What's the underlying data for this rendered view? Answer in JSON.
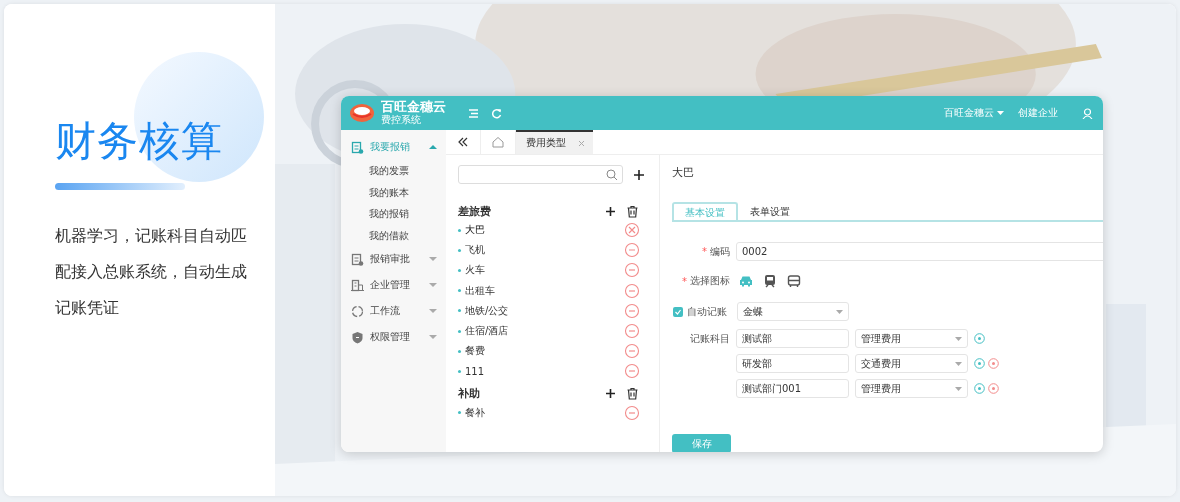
{
  "hero": {
    "title": "财务核算",
    "description": "机器学习，记账科目自动匹配接入总账系统，自动生成记账凭证"
  },
  "app": {
    "brand": {
      "name": "百旺金穗云",
      "subtitle": "费控系统"
    },
    "header": {
      "org": "百旺金穗云",
      "create": "创建企业"
    },
    "sidebar": [
      {
        "label": "我要报销",
        "kind": "receipt",
        "expanded": true,
        "children": [
          {
            "label": "我的发票"
          },
          {
            "label": "我的账本"
          },
          {
            "label": "我的报销"
          },
          {
            "label": "我的借款"
          }
        ]
      },
      {
        "label": "报销审批",
        "kind": "receipt",
        "expanded": false
      },
      {
        "label": "企业管理",
        "kind": "building",
        "expanded": false
      },
      {
        "label": "工作流",
        "kind": "cycle",
        "expanded": false
      },
      {
        "label": "权限管理",
        "kind": "shield",
        "expanded": false
      }
    ],
    "tabs": [
      {
        "label": "费用类型",
        "selected": true
      }
    ],
    "groups": [
      {
        "name": "差旅费",
        "items": [
          {
            "label": "大巴",
            "selected": true
          },
          {
            "label": "飞机",
            "selected": false
          },
          {
            "label": "火车",
            "selected": false
          },
          {
            "label": "出租车",
            "selected": false
          },
          {
            "label": "地铁/公交",
            "selected": false
          },
          {
            "label": "住宿/酒店",
            "selected": false
          },
          {
            "label": "餐费",
            "selected": false
          },
          {
            "label": "111",
            "selected": false
          }
        ]
      },
      {
        "name": "补助",
        "items": [
          {
            "label": "餐补",
            "selected": false
          }
        ]
      }
    ],
    "detail": {
      "title": "大巴",
      "tabs": [
        {
          "label": "基本设置",
          "selected": true
        },
        {
          "label": "表单设置",
          "selected": false
        }
      ],
      "code": {
        "required_mark": "*",
        "label": "编码",
        "value": "0002"
      },
      "icon_choice": {
        "required_mark": "*",
        "label": "选择图标",
        "options": [
          {
            "kind": "car",
            "selected": true
          },
          {
            "kind": "train",
            "selected": false
          },
          {
            "kind": "bus",
            "selected": false
          }
        ]
      },
      "auto_post": {
        "label": "自动记账",
        "checked": true,
        "value": "金蝶"
      },
      "accounts": {
        "label": "记账科目",
        "rows": [
          {
            "department": "测试部",
            "account": "管理费用",
            "removable": false
          },
          {
            "department": "研发部",
            "account": "交通费用",
            "removable": true
          },
          {
            "department": "测试部门001",
            "account": "管理费用",
            "removable": true
          }
        ]
      },
      "save": "保存"
    }
  }
}
